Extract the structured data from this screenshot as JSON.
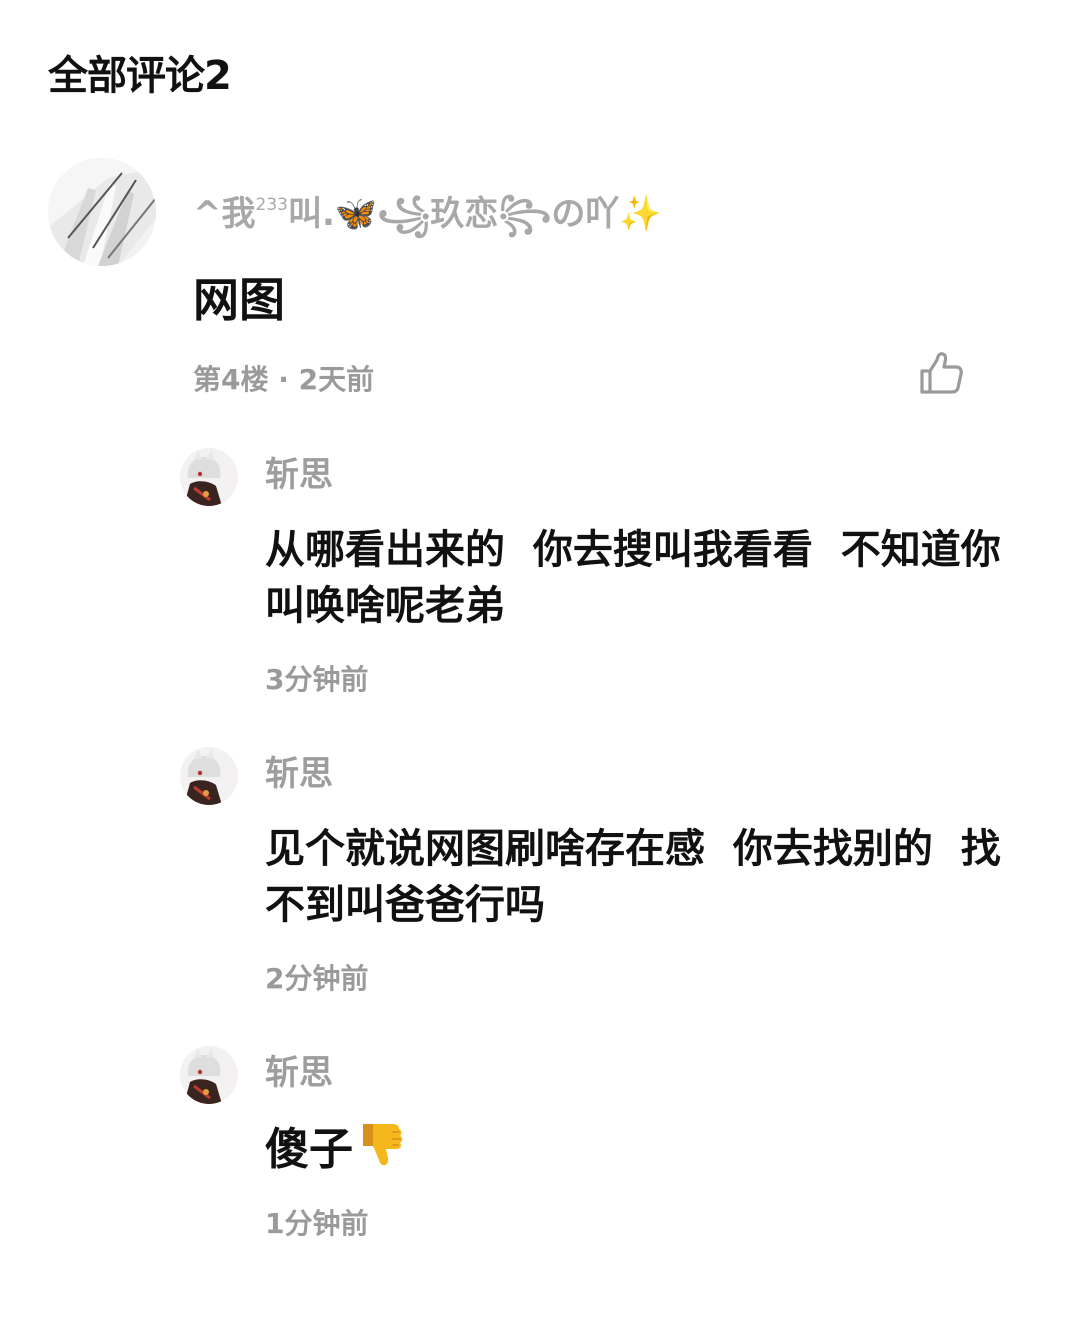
{
  "section": {
    "title": "全部评论2"
  },
  "comment": {
    "username_prefix": "^我",
    "username_sup": "233",
    "username_suffix": "叫.🦋꧁玖恋꧂の吖✨",
    "body": "网图",
    "meta": "第4楼 · 2天前",
    "like_icon": "thumbs-up-icon"
  },
  "replies": [
    {
      "name": "斩思",
      "body": "从哪看出来的  你去搜叫我看看  不知道你叫唤啥呢老弟",
      "time": "3分钟前"
    },
    {
      "name": "斩思",
      "body": "见个就说网图刷啥存在感  你去找别的  找不到叫爸爸行吗",
      "time": "2分钟前"
    },
    {
      "name": "斩思",
      "body": "傻子",
      "emoji": "thumbs-down-emoji",
      "time": "1分钟前"
    }
  ],
  "colors": {
    "title_text": "#111111",
    "secondary_text": "#9a9a9a",
    "emoji_yellow": "#f5b81c"
  }
}
